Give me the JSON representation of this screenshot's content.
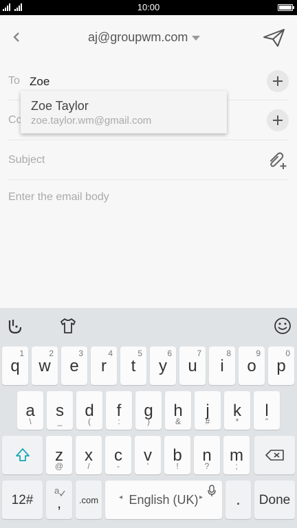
{
  "status_bar": {
    "time": "10:00",
    "battery_level": 1.0
  },
  "header": {
    "account": "aj@groupwm.com"
  },
  "to_field": {
    "label": "To",
    "value": "Zoe"
  },
  "cc_field": {
    "label": "Cc"
  },
  "subject_field": {
    "label": "Subject"
  },
  "body_field": {
    "placeholder": "Enter the email body"
  },
  "suggestion": {
    "name": "Zoe Taylor",
    "email": "zoe.taylor.wm@gmail.com"
  },
  "keyboard": {
    "row1": [
      {
        "key": "q",
        "alt": "1"
      },
      {
        "key": "w",
        "alt": "2"
      },
      {
        "key": "e",
        "alt": "3"
      },
      {
        "key": "r",
        "alt": "4"
      },
      {
        "key": "t",
        "alt": "5"
      },
      {
        "key": "y",
        "alt": "6"
      },
      {
        "key": "u",
        "alt": "7"
      },
      {
        "key": "i",
        "alt": "8"
      },
      {
        "key": "o",
        "alt": "9"
      },
      {
        "key": "p",
        "alt": "0"
      }
    ],
    "row2": [
      {
        "key": "a",
        "alt": "\\"
      },
      {
        "key": "s",
        "alt": "_"
      },
      {
        "key": "d",
        "alt": "("
      },
      {
        "key": "f",
        "alt": ":"
      },
      {
        "key": "g",
        "alt": ")"
      },
      {
        "key": "h",
        "alt": "&"
      },
      {
        "key": "j",
        "alt": "#"
      },
      {
        "key": "k",
        "alt": "*"
      },
      {
        "key": "l",
        "alt": "\""
      }
    ],
    "row3": [
      {
        "key": "z",
        "alt": "@"
      },
      {
        "key": "x",
        "alt": "/"
      },
      {
        "key": "c",
        "alt": "-"
      },
      {
        "key": "v",
        "alt": "'"
      },
      {
        "key": "b",
        "alt": "!"
      },
      {
        "key": "n",
        "alt": "?"
      },
      {
        "key": "m",
        "alt": ";"
      }
    ],
    "symbols_key": "12#",
    "emoji_comma_key": ",",
    "dotcom_key": ".com",
    "space_label": "English (UK)",
    "period_key": ".",
    "done_key": "Done"
  },
  "colors": {
    "accent": "#1aa7b8",
    "keyboard_bg": "#dfe3e6"
  }
}
